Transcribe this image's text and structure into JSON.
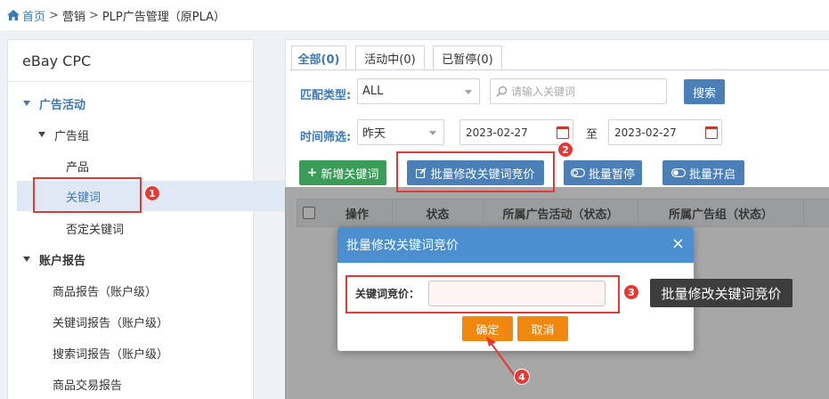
{
  "breadcrumb": {
    "home": "首页",
    "separator": ">",
    "items": [
      "营销",
      "PLP广告管理（原PLA）"
    ]
  },
  "sidebar": {
    "title": "eBay CPC",
    "groups": [
      {
        "label": "广告活动",
        "expanded": true
      },
      {
        "label": "广告组",
        "expanded": true
      },
      {
        "label": "产品"
      },
      {
        "label": "关键词",
        "active": true
      },
      {
        "label": "否定关键词"
      },
      {
        "label": "账户报告",
        "expanded": true
      },
      {
        "label": "商品报告（账户级）"
      },
      {
        "label": "关键词报告（账户级）"
      },
      {
        "label": "搜索词报告（账户级）"
      },
      {
        "label": "商品交易报告"
      }
    ]
  },
  "tabs": [
    {
      "label": "全部(0)",
      "active": true
    },
    {
      "label": "活动中(0)"
    },
    {
      "label": "已暂停(0)"
    }
  ],
  "filters": {
    "match_type_label": "匹配类型:",
    "match_type_value": "ALL",
    "search_placeholder": "请输入关键词",
    "search_button": "搜索",
    "time_label": "时间筛选:",
    "time_value": "昨天",
    "date_from": "2023-02-27",
    "date_to_label": "至",
    "date_to": "2023-02-27"
  },
  "toolbar": {
    "add_keyword": "新增关键词",
    "batch_edit_bid": "批量修改关键词竞价",
    "batch_pause": "批量暂停",
    "batch_start": "批量开启"
  },
  "table": {
    "columns": [
      "操作",
      "状态",
      "所属广告活动（状态）",
      "所属广告组（状态）"
    ]
  },
  "dialog": {
    "title": "批量修改关键词竞价",
    "close": "×",
    "bid_label": "关键词竞价：",
    "bid_value": "",
    "confirm": "确定",
    "cancel": "取消"
  },
  "annotations": {
    "badges": [
      "1",
      "2",
      "3",
      "4"
    ],
    "tooltip": "批量修改关键词竞价",
    "color": "#e53935"
  },
  "colors": {
    "primary": "#4a7fb8",
    "link": "#3c7ab8",
    "success": "#3b9c57",
    "warning": "#f0870f",
    "dialog_header": "#4b8fd0"
  }
}
